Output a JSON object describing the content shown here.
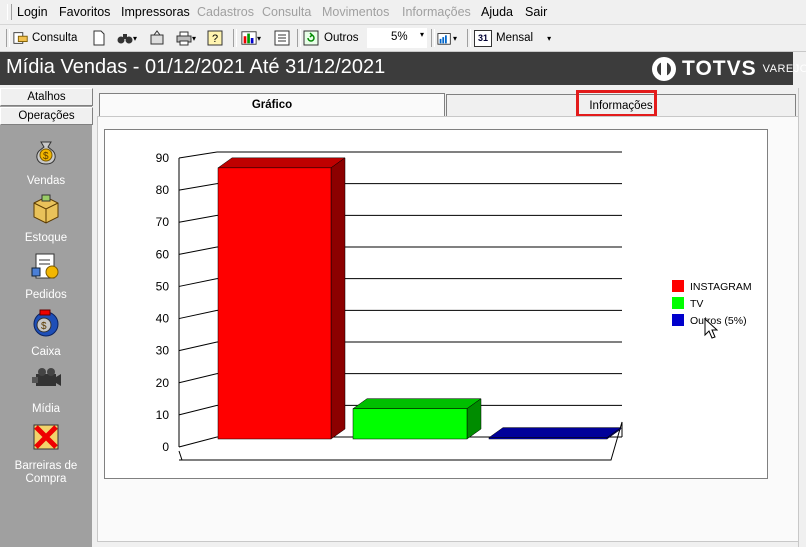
{
  "menu": {
    "items": [
      {
        "label": "Login",
        "enabled": true
      },
      {
        "label": "Favoritos",
        "enabled": true
      },
      {
        "label": "Impressoras",
        "enabled": true
      },
      {
        "label": "Cadastros",
        "enabled": false
      },
      {
        "label": "Consulta",
        "enabled": false
      },
      {
        "label": "Movimentos",
        "enabled": false
      },
      {
        "label": "Informações",
        "enabled": false
      },
      {
        "label": "Ajuda",
        "enabled": true
      },
      {
        "label": "Sair",
        "enabled": true
      }
    ]
  },
  "toolbar": {
    "consulta_label": "Consulta",
    "outros_label": "Outros",
    "percent_value": "5%",
    "period_label": "Mensal",
    "calendar_day": "31"
  },
  "header": {
    "title": "Mídia Vendas  - 01/12/2021 Até  31/12/2021",
    "brand_name": "TOTVS",
    "brand_sub": "VAREJO"
  },
  "sidebar": {
    "atalhos_label": "Atalhos",
    "operacoes_label": "Operações",
    "items": [
      {
        "label": "Vendas",
        "icon": "money-bag-icon"
      },
      {
        "label": "Estoque",
        "icon": "box-icon"
      },
      {
        "label": "Pedidos",
        "icon": "orders-icon"
      },
      {
        "label": "Caixa",
        "icon": "cash-register-icon"
      },
      {
        "label": "Mídia",
        "icon": "media-camera-icon"
      },
      {
        "label": "Barreiras de Compra",
        "icon": "barrier-icon"
      }
    ]
  },
  "tabs": [
    {
      "label": "Gráfico",
      "active": true
    },
    {
      "label": "Informações",
      "active": false
    }
  ],
  "chart_data": {
    "type": "bar",
    "categories": [
      "INSTAGRAM",
      "TV",
      "Outros (5%)"
    ],
    "values": [
      86,
      11,
      2
    ],
    "colors": [
      "#ff0000",
      "#00ff00",
      "#0000cc"
    ],
    "ylim": [
      0,
      90
    ],
    "yticks": [
      0,
      10,
      20,
      30,
      40,
      50,
      60,
      70,
      80,
      90
    ],
    "grid": true,
    "three_d": true,
    "legend_position": "right",
    "legend": [
      "INSTAGRAM",
      "TV",
      "Outros (5%)"
    ]
  }
}
